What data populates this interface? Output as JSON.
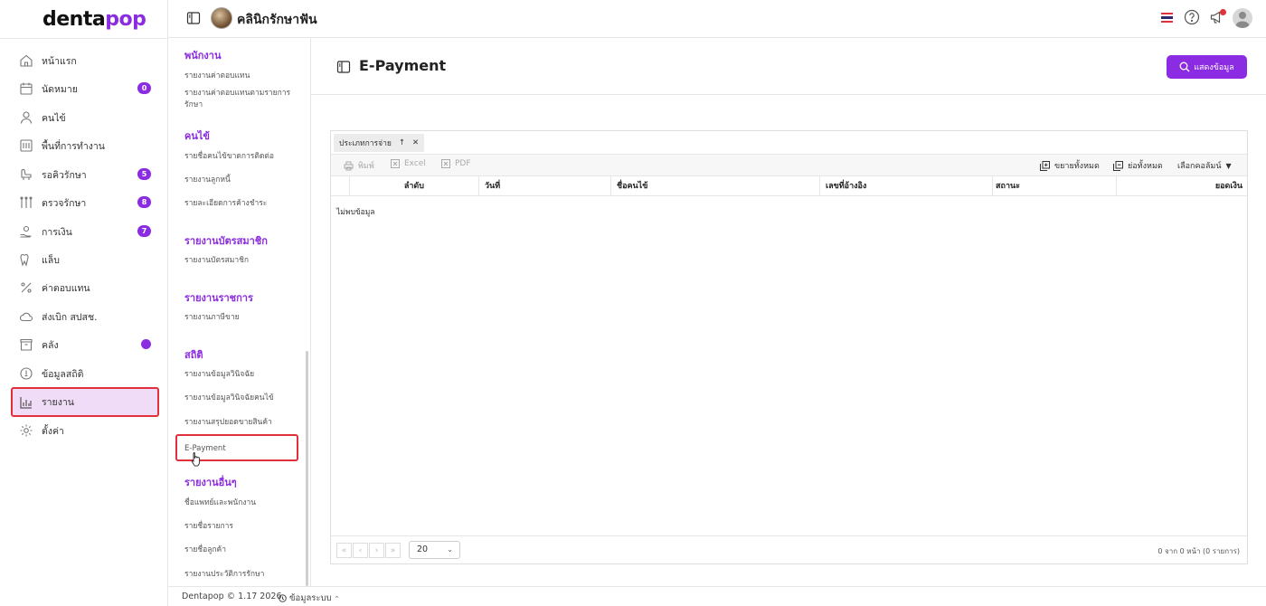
{
  "brand": {
    "logo_part1": "denta",
    "logo_part2": "pop",
    "accent": "#8b2be2",
    "active_border": "#e0303b"
  },
  "nav": {
    "items": [
      {
        "label": "หน้าแรก",
        "icon": "home-icon"
      },
      {
        "label": "นัดหมาย",
        "icon": "calendar-icon",
        "badge": "0"
      },
      {
        "label": "คนไข้",
        "icon": "user-icon"
      },
      {
        "label": "พื้นที่การทำงาน",
        "icon": "workspace-icon"
      },
      {
        "label": "รอคิวรักษา",
        "icon": "dental-chair-icon",
        "badge": "5"
      },
      {
        "label": "ตรวจรักษา",
        "icon": "dental-tools-icon",
        "badge": "8"
      },
      {
        "label": "การเงิน",
        "icon": "money-hand-icon",
        "badge": "7"
      },
      {
        "label": "แล็บ",
        "icon": "tooth-icon"
      },
      {
        "label": "ค่าตอบแทน",
        "icon": "percent-icon"
      },
      {
        "label": "ส่งเบิก สปสช.",
        "icon": "cloud-icon"
      },
      {
        "label": "คลัง",
        "icon": "box-icon",
        "dot": true
      },
      {
        "label": "ข้อมูลสถิติ",
        "icon": "info-circle-icon"
      },
      {
        "label": "รายงาน",
        "icon": "bar-chart-icon",
        "active": true
      },
      {
        "label": "ตั้งค่า",
        "icon": "gear-icon"
      }
    ]
  },
  "submenu": {
    "groups": [
      {
        "title": "พนักงาน",
        "items": [
          "รายงานค่าตอบแทน",
          "รายงานค่าตอบแทนตามรายการรักษา"
        ]
      },
      {
        "title": "คนไข้",
        "items": [
          "รายชื่อคนไข้ขาดการติดต่อ",
          "รายงานลูกหนี้",
          "รายละเอียดการค้างชำระ"
        ]
      },
      {
        "title": "รายงานบัตรสมาชิก",
        "items": [
          "รายงานบัตรสมาชิก"
        ]
      },
      {
        "title": "รายงานราชการ",
        "items": [
          "รายงานภาษีขาย"
        ]
      },
      {
        "title": "สถิติ",
        "items": [
          "รายงานข้อมูลวินิจฉัย",
          "รายงานข้อมูลวินิจฉัยคนไข้",
          "รายงานสรุปยอดขายสินค้า",
          "E-Payment"
        ]
      },
      {
        "title": "รายงานอื่นๆ",
        "items": [
          "ชื่อแพทย์และพนักงาน",
          "รายชื่อรายการ",
          "รายชื่อลูกค้า",
          "รายงานประวัติการรักษา"
        ]
      }
    ],
    "active_item": "E-Payment"
  },
  "topbar": {
    "clinic_name": "คลินิกรักษาฟัน"
  },
  "page": {
    "title": "E-Payment",
    "show_button": "แสดงข้อมูล"
  },
  "grid": {
    "group_chip": "ประเภทการจ่าย",
    "toolbar": {
      "print": "พิมพ์",
      "excel": "Excel",
      "pdf": "PDF",
      "expand_all": "ขยายทั้งหมด",
      "collapse_all": "ย่อทั้งหมด",
      "choose_columns": "เลือกคอลัมน์"
    },
    "columns": [
      "ลำดับ",
      "วันที่",
      "ชื่อคนไข้",
      "เลขที่อ้างอิง",
      "สถานะ",
      "ยอดเงิน"
    ],
    "empty_text": "ไม่พบข้อมูล",
    "pager": {
      "page_size": "20",
      "info": "0 จาก 0 หน้า (0 รายการ)"
    }
  },
  "footer": {
    "copyright": "Dentapop © 1.17 2026",
    "system_info": "ข้อมูลระบบ"
  }
}
